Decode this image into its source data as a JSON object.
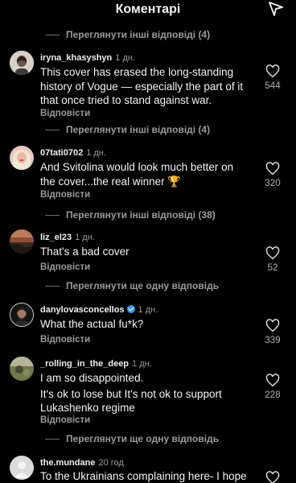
{
  "header": {
    "title": "Коментарі"
  },
  "top_view_replies": "Переглянути інші відповіді (4)",
  "comments": [
    {
      "username": "iryna_khasyshyn",
      "time": "1 дн.",
      "lines": [
        "This cover has erased the long-standing",
        "history of Vogue — especially the part of it",
        "that once tried to stand against war."
      ],
      "reply_label": "Відповісти",
      "likes": "544",
      "view_replies": "Переглянути інші відповіді (4)"
    },
    {
      "username": "07tati0702",
      "time": "1 дн.",
      "lines": [
        "And Svitolina would look much better on",
        "the cover...the real winner 🏆"
      ],
      "reply_label": "Відповісти",
      "likes": "320",
      "view_replies": "Переглянути інші відповіді (38)"
    },
    {
      "username": "liz_el23",
      "time": "1 дн.",
      "lines": [
        "That's a bad cover"
      ],
      "reply_label": "Відповісти",
      "likes": "52",
      "view_replies": "Переглянути ще одну відповідь"
    },
    {
      "username": "danylovasconcellos",
      "time": "1 дн.",
      "verified": true,
      "lines": [
        "What the actual fu*k?"
      ],
      "reply_label": "Відповісти",
      "likes": "339"
    },
    {
      "username": "_rolling_in_the_deep",
      "time": "1 дн.",
      "lines": [
        "I am so disappointed.",
        "It's ok to lose but It's not ok to support",
        "Lukashenko regime"
      ],
      "reply_label": "Відповісти",
      "likes": "228",
      "view_replies": "Переглянути ще одну відповідь"
    },
    {
      "username": "the.mundane",
      "time": "20 год",
      "lines": [
        "To the Ukrainians complaining here- I hope"
      ]
    }
  ]
}
